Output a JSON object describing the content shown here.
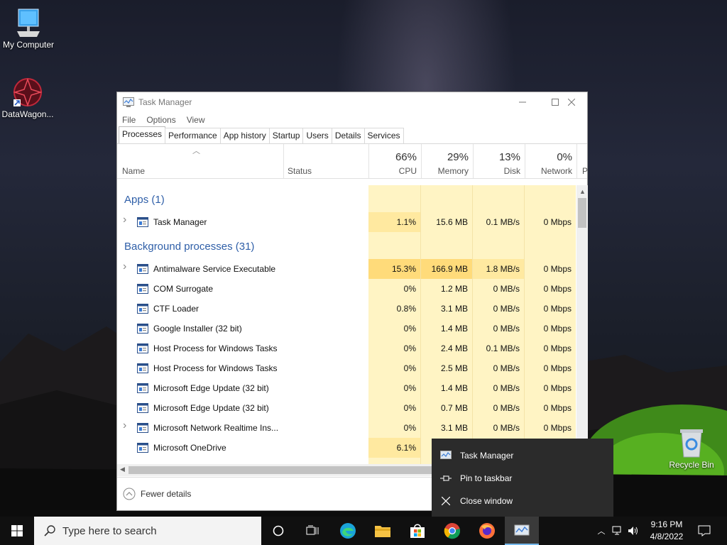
{
  "desktop": {
    "icons": [
      {
        "label": "My Computer",
        "icon": "my-computer-icon"
      },
      {
        "label": "DataWagon...",
        "icon": "datawagon-icon"
      },
      {
        "label": "Recycle Bin",
        "icon": "recycle-bin-icon"
      }
    ]
  },
  "window": {
    "title": "Task Manager",
    "menu": [
      "File",
      "Options",
      "View"
    ],
    "tabs": [
      "Processes",
      "Performance",
      "App history",
      "Startup",
      "Users",
      "Details",
      "Services"
    ],
    "active_tab": "Processes",
    "columns": {
      "name": "Name",
      "status": "Status",
      "cpu": {
        "pct": "66%",
        "label": "CPU"
      },
      "memory": {
        "pct": "29%",
        "label": "Memory"
      },
      "disk": {
        "pct": "13%",
        "label": "Disk"
      },
      "network": {
        "pct": "0%",
        "label": "Network"
      },
      "power_cut": "P"
    },
    "groups": {
      "apps": "Apps (1)",
      "background": "Background processes (31)"
    },
    "apps": [
      {
        "name": "Task Manager",
        "cpu": "1.1%",
        "memory": "15.6 MB",
        "disk": "0.1 MB/s",
        "network": "0 Mbps",
        "expandable": true
      }
    ],
    "background": [
      {
        "name": "Antimalware Service Executable",
        "cpu": "15.3%",
        "memory": "166.9 MB",
        "disk": "1.8 MB/s",
        "network": "0 Mbps",
        "expandable": true
      },
      {
        "name": "COM Surrogate",
        "cpu": "0%",
        "memory": "1.2 MB",
        "disk": "0 MB/s",
        "network": "0 Mbps",
        "expandable": false
      },
      {
        "name": "CTF Loader",
        "cpu": "0.8%",
        "memory": "3.1 MB",
        "disk": "0 MB/s",
        "network": "0 Mbps",
        "expandable": false
      },
      {
        "name": "Google Installer (32 bit)",
        "cpu": "0%",
        "memory": "1.4 MB",
        "disk": "0 MB/s",
        "network": "0 Mbps",
        "expandable": false
      },
      {
        "name": "Host Process for Windows Tasks",
        "cpu": "0%",
        "memory": "2.4 MB",
        "disk": "0.1 MB/s",
        "network": "0 Mbps",
        "expandable": false
      },
      {
        "name": "Host Process for Windows Tasks",
        "cpu": "0%",
        "memory": "2.5 MB",
        "disk": "0 MB/s",
        "network": "0 Mbps",
        "expandable": false
      },
      {
        "name": "Microsoft Edge Update (32 bit)",
        "cpu": "0%",
        "memory": "1.4 MB",
        "disk": "0 MB/s",
        "network": "0 Mbps",
        "expandable": false
      },
      {
        "name": "Microsoft Edge Update (32 bit)",
        "cpu": "0%",
        "memory": "0.7 MB",
        "disk": "0 MB/s",
        "network": "0 Mbps",
        "expandable": false
      },
      {
        "name": "Microsoft Network Realtime Ins...",
        "cpu": "0%",
        "memory": "3.1 MB",
        "disk": "0 MB/s",
        "network": "0 Mbps",
        "expandable": true
      },
      {
        "name": "Microsoft OneDrive",
        "cpu": "6.1%",
        "memory": "",
        "disk": "",
        "network": "",
        "expandable": false
      }
    ],
    "footer": "Fewer details"
  },
  "context_menu": {
    "items": [
      {
        "label": "Task Manager",
        "icon": "task-manager-icon"
      },
      {
        "label": "Pin to taskbar",
        "icon": "pin-icon"
      },
      {
        "label": "Close window",
        "icon": "close-icon"
      }
    ]
  },
  "taskbar": {
    "search_placeholder": "Type here to search",
    "time": "9:16 PM",
    "date": "4/8/2022"
  },
  "colors": {
    "group_title": "#2f5fa8",
    "heat_light": "#fff4c4",
    "heat_medium": "#ffe9a0",
    "heat_strong": "#ffdb7a",
    "taskbar": "#101010",
    "context_menu": "#2b2b2b"
  }
}
